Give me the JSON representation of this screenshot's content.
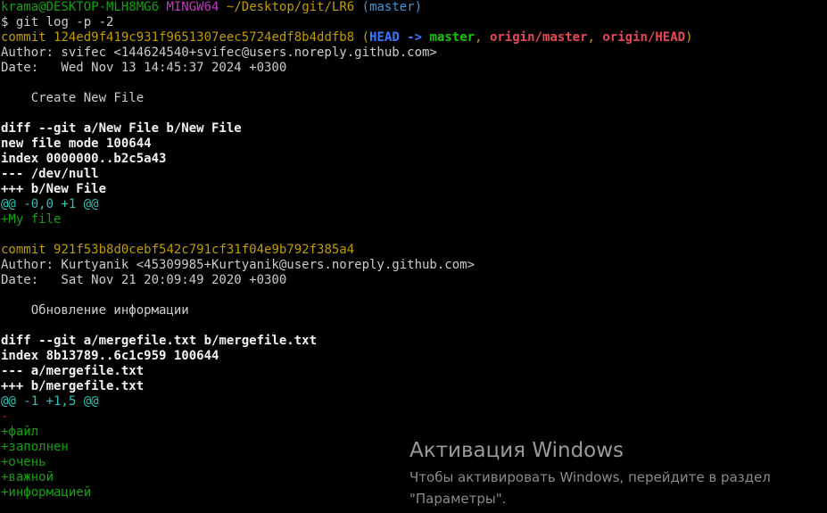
{
  "prompt": {
    "user_host": "krama@DESKTOP-MLH8MG6",
    "system": "MINGW64",
    "path": "~/Desktop/git/LR6",
    "branch": "(master)",
    "symbol": "$",
    "command": "git log -p -2"
  },
  "commit1": {
    "label": "commit",
    "hash": "124ed9f419c931f9651307eec5724edf8b4ddfb8",
    "refs_open": "(",
    "head": "HEAD ->",
    "master": "master",
    "sep1": ", ",
    "origin_master": "origin/master",
    "sep2": ", ",
    "origin_head": "origin/HEAD",
    "refs_close": ")",
    "author": "Author: svifec <144624540+svifec@users.noreply.github.com>",
    "date": "Date:   Wed Nov 13 14:45:37 2024 +0300",
    "message": "    Create New File",
    "diff_header": "diff --git a/New File b/New File",
    "mode": "new file mode 100644",
    "index": "index 0000000..b2c5a43",
    "minus_file": "--- /dev/null",
    "plus_file": "+++ b/New File",
    "hunk": "@@ -0,0 +1 @@",
    "added": [
      "+My file"
    ]
  },
  "commit2": {
    "label": "commit",
    "hash": "921f53b8d0cebf542c791cf31f04e9b792f385a4",
    "author": "Author: Kurtyanik <45309985+Kurtyanik@users.noreply.github.com>",
    "date": "Date:   Sat Nov 21 20:09:49 2020 +0300",
    "message": "    Обновление информации",
    "diff_header": "diff --git a/mergefile.txt b/mergefile.txt",
    "index": "index 8b13789..6c1c959 100644",
    "minus_file": "--- a/mergefile.txt",
    "plus_file": "+++ b/mergefile.txt",
    "hunk": "@@ -1 +1,5 @@",
    "removed": "-",
    "added": [
      "+файл",
      "+заполнен",
      "+очень",
      "+важной",
      "+информацией"
    ]
  },
  "watermark": {
    "title": "Активация Windows",
    "line1": "Чтобы активировать Windows, перейдите в раздел",
    "line2": "\"Параметры\"."
  }
}
